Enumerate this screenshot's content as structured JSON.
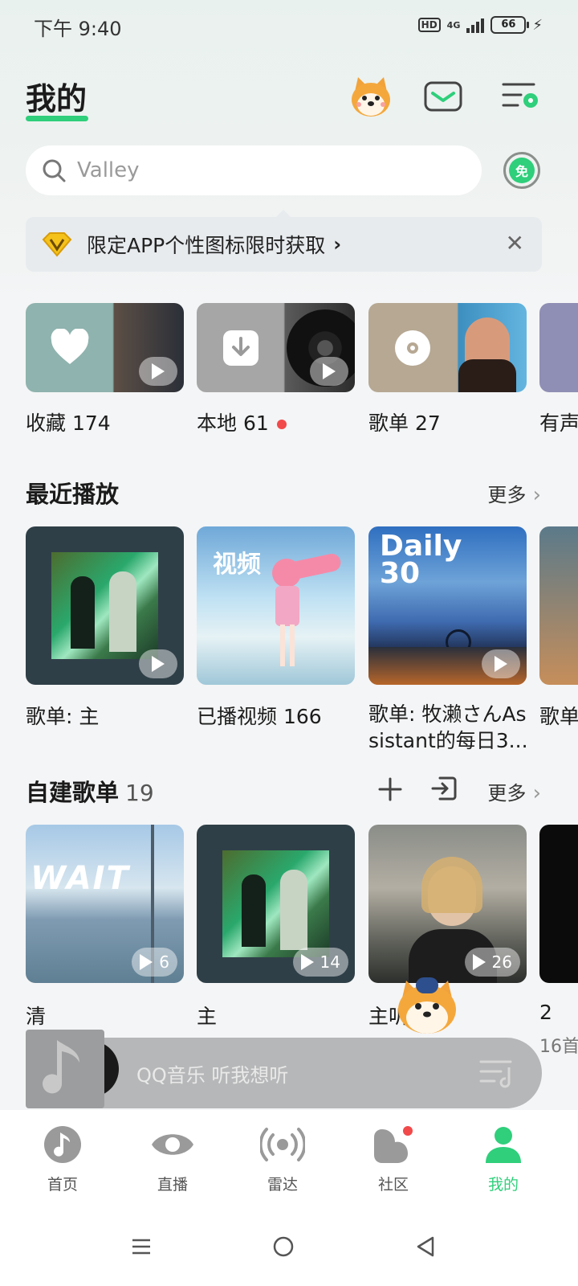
{
  "status": {
    "time": "下午 9:40",
    "hd": "HD",
    "network": "4G",
    "battery": "66"
  },
  "header": {
    "title": "我的"
  },
  "search": {
    "placeholder": "Valley",
    "free_label": "免"
  },
  "promo": {
    "text": "限定APP个性图标限时获取",
    "chevron": "›",
    "close": "✕"
  },
  "library": [
    {
      "label": "收藏 174"
    },
    {
      "label": "本地 61"
    },
    {
      "label": "歌单 27"
    },
    {
      "label": "有声"
    }
  ],
  "recent": {
    "title": "最近播放",
    "more": "更多",
    "items": [
      {
        "label": "歌单: 主"
      },
      {
        "label": "已播视频 166",
        "overlay": "视频"
      },
      {
        "label_line1": "歌单: 牧濑さんAs",
        "label_line2": "sistant的每日3...",
        "overlay_line1": "Daily",
        "overlay_line2": "30"
      },
      {
        "label": "歌单"
      }
    ]
  },
  "playlists": {
    "title": "自建歌单",
    "count": "19",
    "more": "更多",
    "items": [
      {
        "label": "清",
        "plays": "6"
      },
      {
        "label": "主",
        "plays": "14"
      },
      {
        "label": "主听",
        "plays": "26"
      },
      {
        "label": "2",
        "sub": "16首"
      }
    ]
  },
  "mini_player": {
    "text": "QQ音乐 听我想听"
  },
  "nav": [
    {
      "label": "首页"
    },
    {
      "label": "直播"
    },
    {
      "label": "雷达"
    },
    {
      "label": "社区"
    },
    {
      "label": "我的"
    }
  ],
  "colors": {
    "accent": "#2fcf7b",
    "dot": "#f2494b"
  }
}
